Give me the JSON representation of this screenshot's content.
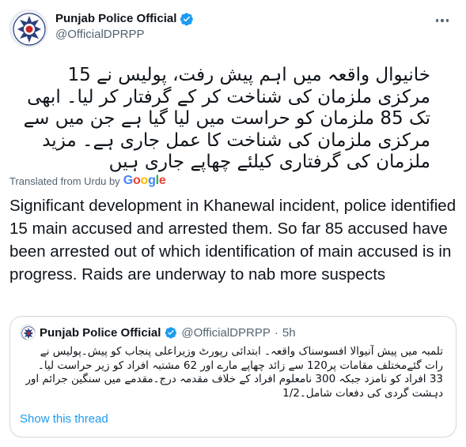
{
  "author": {
    "name": "Punjab Police Official",
    "handle": "@OfficialDPRPP"
  },
  "tweet": {
    "urdu_text": "خانیوال واقعہ میں اہم پیش رفت، پولیس نے 15 مرکزی ملزمان کی شناخت کر کے گرفتار کر لیا۔ ابھی تک 85 ملزمان کو حراست میں لیا گیا ہے جن میں سے مرکزی ملزمان کی شناخت کا عمل جاری ہے۔ مزید ملزمان کی گرفتاری کیلئے چھاپے جاری ہیں",
    "translated_label": "Translated from Urdu by",
    "google": [
      "G",
      "o",
      "o",
      "g",
      "l",
      "e"
    ],
    "english_text": "Significant development in Khanewal incident, police identified 15 main accused and arrested them. So far 85 accused have been arrested out of which identification of main accused is in progress. Raids are underway to nab more suspects"
  },
  "quoted": {
    "name": "Punjab Police Official",
    "handle": "@OfficialDPRPP",
    "separator": "·",
    "time": "5h",
    "urdu_text": "تلمبہ میں پیش آنیوالا افسوسناک واقعہ۔ ابتدائی رپورٹ وزیراعلی پنجاب کو پیش۔پولیس نے رات گئےمختلف مقامات پر120 سے زائد چھاپے مارے اور 62 مشتبہ افراد کو زیر حراست لیا۔ 33 افراد کو نامزد جبکہ 300 نامعلوم افراد کے خلاف مقدمہ درج۔مقدمے میں سنگین جرائم اور دہشت گردی کی دفعات شامل۔1/2",
    "show_thread": "Show this thread"
  },
  "colors": {
    "verified": "#1d9bf0",
    "link": "#1d9bf0",
    "secondary_text": "#536471",
    "border": "#cfd9de"
  },
  "icons": [
    "police-badge-avatar-icon",
    "verified-badge-icon",
    "more-options-icon"
  ]
}
